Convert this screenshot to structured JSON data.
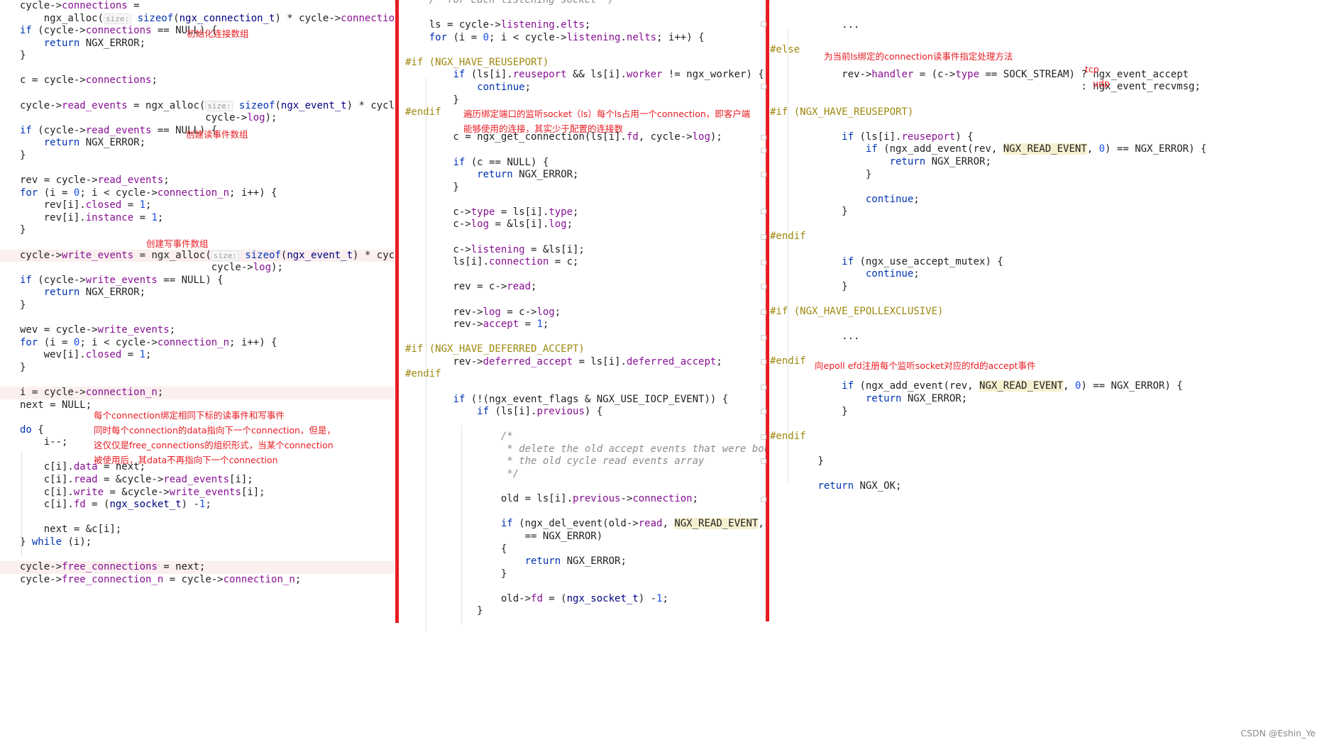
{
  "colors": {
    "keyword": "#0033b3",
    "field": "#871094",
    "number": "#1750eb",
    "comment": "#8c8c8c",
    "preproc": "#9e880d",
    "type": "#000080",
    "hint": "#9b9b9b",
    "annotation": "#e81c23",
    "separator": "#e81c23",
    "highlight_line": "#fbefef",
    "macro_bg": "#f5f0cf"
  },
  "columns": [
    {
      "name": "left",
      "lines": [
        {
          "text": "cycle->connections ="
        },
        {
          "text": "    ngx_alloc(size: sizeof(ngx_connection_t) * cycle->connection_n, cycle->log);"
        },
        {
          "text": "if (cycle->connections == NULL) {"
        },
        {
          "text": "    return NGX_ERROR;"
        },
        {
          "text": "}"
        },
        {
          "text": ""
        },
        {
          "text": "c = cycle->connections;"
        },
        {
          "text": ""
        },
        {
          "text": "cycle->read_events = ngx_alloc(size: sizeof(ngx_event_t) * cycle->connection_n,"
        },
        {
          "text": "                               cycle->log);"
        },
        {
          "text": "if (cycle->read_events == NULL) {"
        },
        {
          "text": "    return NGX_ERROR;"
        },
        {
          "text": "}"
        },
        {
          "text": ""
        },
        {
          "text": "rev = cycle->read_events;"
        },
        {
          "text": "for (i = 0; i < cycle->connection_n; i++) {"
        },
        {
          "text": "    rev[i].closed = 1;"
        },
        {
          "text": "    rev[i].instance = 1;"
        },
        {
          "text": "}"
        },
        {
          "text": ""
        },
        {
          "text": "cycle->write_events = ngx_alloc(size: sizeof(ngx_event_t) * cycle->connection_n,",
          "hl": true
        },
        {
          "text": "                                cycle->log);"
        },
        {
          "text": "if (cycle->write_events == NULL) {"
        },
        {
          "text": "    return NGX_ERROR;"
        },
        {
          "text": "}"
        },
        {
          "text": ""
        },
        {
          "text": "wev = cycle->write_events;"
        },
        {
          "text": "for (i = 0; i < cycle->connection_n; i++) {"
        },
        {
          "text": "    wev[i].closed = 1;"
        },
        {
          "text": "}"
        },
        {
          "text": ""
        },
        {
          "text": "i = cycle->connection_n;",
          "hl": true
        },
        {
          "text": "next = NULL;"
        },
        {
          "text": ""
        },
        {
          "text": "do {"
        },
        {
          "text": "    i--;"
        },
        {
          "text": ""
        },
        {
          "text": "    c[i].data = next;"
        },
        {
          "text": "    c[i].read = &cycle->read_events[i];"
        },
        {
          "text": "    c[i].write = &cycle->write_events[i];"
        },
        {
          "text": "    c[i].fd = (ngx_socket_t) -1;"
        },
        {
          "text": ""
        },
        {
          "text": "    next = &c[i];"
        },
        {
          "text": "} while (i);"
        },
        {
          "text": ""
        },
        {
          "text": "cycle->free_connections = next;",
          "hl": true
        },
        {
          "text": "cycle->free_connection_n = cycle->connection_n;"
        }
      ]
    },
    {
      "name": "middle",
      "lines": [
        {
          "text": "    /* for each listening socket */"
        },
        {
          "text": ""
        },
        {
          "text": "    ls = cycle->listening.elts;"
        },
        {
          "text": "    for (i = 0; i < cycle->listening.nelts; i++) {"
        },
        {
          "text": ""
        },
        {
          "text": "#if (NGX_HAVE_REUSEPORT)"
        },
        {
          "text": "        if (ls[i].reuseport && ls[i].worker != ngx_worker) {"
        },
        {
          "text": "            continue;"
        },
        {
          "text": "        }"
        },
        {
          "text": "#endif"
        },
        {
          "text": ""
        },
        {
          "text": "        c = ngx_get_connection(ls[i].fd, cycle->log);"
        },
        {
          "text": ""
        },
        {
          "text": "        if (c == NULL) {"
        },
        {
          "text": "            return NGX_ERROR;"
        },
        {
          "text": "        }"
        },
        {
          "text": ""
        },
        {
          "text": "        c->type = ls[i].type;"
        },
        {
          "text": "        c->log = &ls[i].log;"
        },
        {
          "text": ""
        },
        {
          "text": "        c->listening = &ls[i];"
        },
        {
          "text": "        ls[i].connection = c;"
        },
        {
          "text": ""
        },
        {
          "text": "        rev = c->read;"
        },
        {
          "text": ""
        },
        {
          "text": "        rev->log = c->log;"
        },
        {
          "text": "        rev->accept = 1;"
        },
        {
          "text": ""
        },
        {
          "text": "#if (NGX_HAVE_DEFERRED_ACCEPT)"
        },
        {
          "text": "        rev->deferred_accept = ls[i].deferred_accept;"
        },
        {
          "text": "#endif"
        },
        {
          "text": ""
        },
        {
          "text": "        if (!(ngx_event_flags & NGX_USE_IOCP_EVENT)) {"
        },
        {
          "text": "            if (ls[i].previous) {"
        },
        {
          "text": ""
        },
        {
          "text": "                /*"
        },
        {
          "text": "                 * delete the old accept events that were bound to"
        },
        {
          "text": "                 * the old cycle read events array"
        },
        {
          "text": "                 */"
        },
        {
          "text": ""
        },
        {
          "text": "                old = ls[i].previous->connection;"
        },
        {
          "text": ""
        },
        {
          "text": "                if (ngx_del_event(old->read, NGX_READ_EVENT, NGX_CLOSE_EVENT)"
        },
        {
          "text": "                    == NGX_ERROR)"
        },
        {
          "text": "                {"
        },
        {
          "text": "                    return NGX_ERROR;"
        },
        {
          "text": "                }"
        },
        {
          "text": ""
        },
        {
          "text": "                old->fd = (ngx_socket_t) -1;"
        },
        {
          "text": "            }"
        }
      ]
    },
    {
      "name": "right",
      "lines": [
        {
          "text": ""
        },
        {
          "text": "            ..."
        },
        {
          "text": ""
        },
        {
          "text": "#else"
        },
        {
          "text": ""
        },
        {
          "text": "            rev->handler = (c->type == SOCK_STREAM) ? ngx_event_accept"
        },
        {
          "text": "                                                    : ngx_event_recvmsg;"
        },
        {
          "text": ""
        },
        {
          "text": "#if (NGX_HAVE_REUSEPORT)"
        },
        {
          "text": ""
        },
        {
          "text": "            if (ls[i].reuseport) {"
        },
        {
          "text": "                if (ngx_add_event(rev, NGX_READ_EVENT, 0) == NGX_ERROR) {"
        },
        {
          "text": "                    return NGX_ERROR;"
        },
        {
          "text": "                }"
        },
        {
          "text": ""
        },
        {
          "text": "                continue;"
        },
        {
          "text": "            }"
        },
        {
          "text": ""
        },
        {
          "text": "#endif"
        },
        {
          "text": ""
        },
        {
          "text": "            if (ngx_use_accept_mutex) {"
        },
        {
          "text": "                continue;"
        },
        {
          "text": "            }"
        },
        {
          "text": ""
        },
        {
          "text": "#if (NGX_HAVE_EPOLLEXCLUSIVE)"
        },
        {
          "text": ""
        },
        {
          "text": "            ..."
        },
        {
          "text": ""
        },
        {
          "text": "#endif"
        },
        {
          "text": ""
        },
        {
          "text": "            if (ngx_add_event(rev, NGX_READ_EVENT, 0) == NGX_ERROR) {"
        },
        {
          "text": "                return NGX_ERROR;"
        },
        {
          "text": "            }"
        },
        {
          "text": ""
        },
        {
          "text": "#endif"
        },
        {
          "text": ""
        },
        {
          "text": "        }"
        },
        {
          "text": ""
        },
        {
          "text": "        return NGX_OK;"
        }
      ]
    }
  ],
  "annotations": [
    {
      "id": "conn-array",
      "text": "初始化连接数组"
    },
    {
      "id": "read-events",
      "text": "创建读事件数组"
    },
    {
      "id": "write-events",
      "text": "创建写事件数组"
    },
    {
      "id": "bind-1",
      "text": "每个connection绑定相同下标的读事件和写事件"
    },
    {
      "id": "bind-2",
      "text": "同时每个connection的data指向下一个connection，但是，"
    },
    {
      "id": "bind-3",
      "text": "这仅仅是free_connections的组织形式，当某个connection"
    },
    {
      "id": "bind-4",
      "text": "被使用后，其data不再指向下一个connection"
    },
    {
      "id": "listen-1",
      "text": "遍历绑定端口的监听socket（ls）每个ls占用一个connection，即客户端"
    },
    {
      "id": "listen-2",
      "text": "能够使用的连接，其实少于配置的连接数"
    },
    {
      "id": "handler",
      "text": "为当前ls绑定的connection读事件指定处理方法"
    },
    {
      "id": "tcp",
      "text": "tcp"
    },
    {
      "id": "udp",
      "text": "udp"
    },
    {
      "id": "epoll",
      "text": "向epoll efd注册每个监听socket对应的fd的accept事件"
    }
  ],
  "watermark": "CSDN @Eshin_Ye"
}
